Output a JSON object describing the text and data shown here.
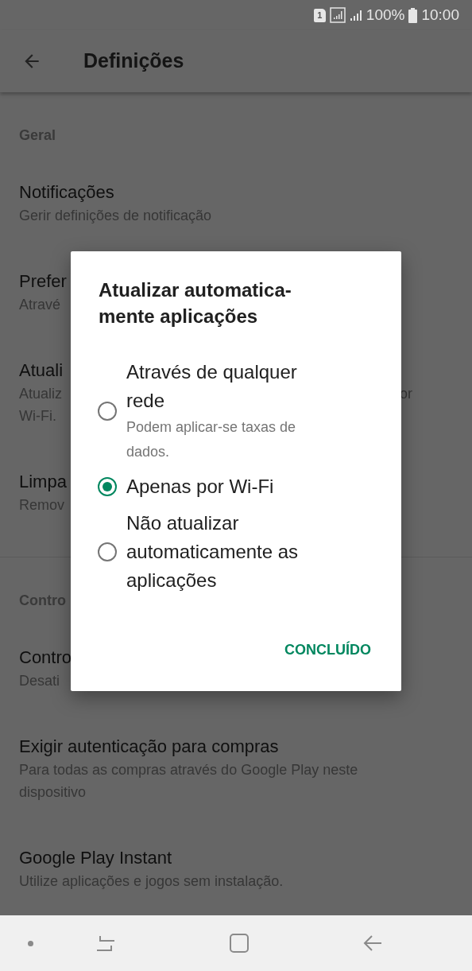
{
  "status_bar": {
    "sim": "1",
    "battery": "100%",
    "time": "10:00"
  },
  "toolbar": {
    "title": "Definições"
  },
  "sections": [
    {
      "header": "Geral",
      "items": [
        {
          "title": "Notificações",
          "subtitle_lines": [
            "Gerir definições de notificação"
          ]
        },
        {
          "title": "Prefer",
          "subtitle_lines": [
            "Atravé"
          ]
        },
        {
          "title": "Atuali",
          "subtitle_lines": [
            "Atualiz",
            "Wi-Fi."
          ],
          "subtitle_tail": "or"
        },
        {
          "title": "Limpa",
          "subtitle_lines": [
            "Remov"
          ]
        }
      ]
    },
    {
      "header": "Contro",
      "items": [
        {
          "title": "Contro",
          "subtitle_lines": [
            "Desati"
          ]
        },
        {
          "title": "Exigir autenticação para compras",
          "subtitle_lines": [
            "Para todas as compras através do Google Play neste",
            "dispositivo"
          ]
        },
        {
          "title": "Google Play Instant",
          "subtitle_lines": [
            "Utilize aplicações e jogos sem instalação."
          ]
        }
      ]
    }
  ],
  "dialog": {
    "title_lines": [
      "Atualizar automatica-",
      "mente aplicações"
    ],
    "options": [
      {
        "label": "Através de qualquer rede",
        "description": "Podem aplicar-se taxas de dados.",
        "selected": false
      },
      {
        "label": "Apenas por Wi-Fi",
        "selected": true
      },
      {
        "label": "Não atualizar automaticamente as aplicações",
        "selected": false
      }
    ],
    "button": "CONCLUÍDO"
  }
}
